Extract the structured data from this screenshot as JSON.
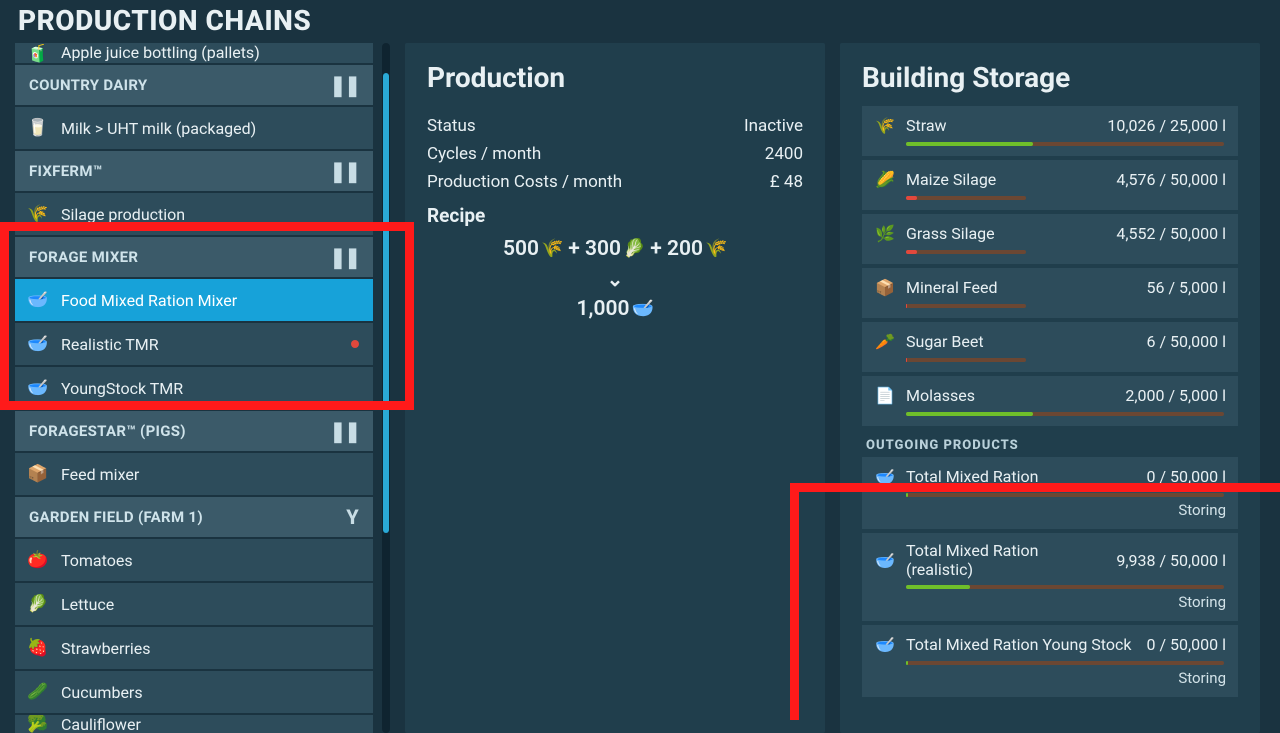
{
  "header": {
    "title": "PRODUCTION CHAINS"
  },
  "sidebar": {
    "top_partial": {
      "label": "Apple juice bottling (pallets)",
      "icon": "🧃"
    },
    "groups": [
      {
        "name": "COUNTRY DAIRY",
        "paused": true,
        "items": [
          {
            "label": "Milk > UHT milk (packaged)",
            "icon": "🥛"
          }
        ]
      },
      {
        "name": "FIXFERM™",
        "paused": true,
        "items": [
          {
            "label": "Silage production",
            "icon": "🌾"
          }
        ]
      },
      {
        "name": "FORAGE MIXER",
        "paused": true,
        "items": [
          {
            "label": "Food Mixed Ration Mixer",
            "icon": "🥣",
            "selected": true
          },
          {
            "label": "Realistic TMR",
            "icon": "🥣",
            "dot": true
          },
          {
            "label": "YoungStock TMR",
            "icon": "🥣"
          }
        ]
      },
      {
        "name": "FORAGESTAR™ (PIGS)",
        "paused": true,
        "items": [
          {
            "label": "Feed mixer",
            "icon": "📦"
          }
        ]
      },
      {
        "name": "GARDEN FIELD (FARM 1)",
        "y": true,
        "items": [
          {
            "label": "Tomatoes",
            "icon": "🍅"
          },
          {
            "label": "Lettuce",
            "icon": "🥬"
          },
          {
            "label": "Strawberries",
            "icon": "🍓"
          },
          {
            "label": "Cucumbers",
            "icon": "🥒"
          },
          {
            "label": "Cauliflower",
            "icon": "🥦"
          }
        ]
      }
    ]
  },
  "production": {
    "title": "Production",
    "rows": [
      {
        "label": "Status",
        "value": "Inactive"
      },
      {
        "label": "Cycles / month",
        "value": "2400"
      },
      {
        "label": "Production Costs / month",
        "value": "£ 48"
      }
    ],
    "recipe_label": "Recipe",
    "recipe": {
      "inputs": [
        {
          "qty": "500",
          "icon": "🌾"
        },
        {
          "qty": "300",
          "icon": "🥬"
        },
        {
          "qty": "200",
          "icon": "🌾"
        }
      ],
      "plus": "+",
      "output": {
        "qty": "1,000",
        "icon": "🥣"
      }
    }
  },
  "storage": {
    "title": "Building Storage",
    "items": [
      {
        "name": "Straw",
        "value": "10,026",
        "cap": "25,000 l",
        "icon": "🌾",
        "fill": 40,
        "low": false
      },
      {
        "name": "Maize Silage",
        "value": "4,576",
        "cap": "50,000 l",
        "icon": "🌽",
        "fill": 9,
        "low": true
      },
      {
        "name": "Grass Silage",
        "value": "4,552",
        "cap": "50,000 l",
        "icon": "🌿",
        "fill": 9,
        "low": true
      },
      {
        "name": "Mineral Feed",
        "value": "56",
        "cap": "5,000 l",
        "icon": "📦",
        "fill": 1,
        "low": true
      },
      {
        "name": "Sugar Beet",
        "value": "6",
        "cap": "50,000 l",
        "icon": "🥕",
        "fill": 0.5,
        "low": true
      },
      {
        "name": "Molasses",
        "value": "2,000",
        "cap": "5,000 l",
        "icon": "📄",
        "fill": 40,
        "low": false
      }
    ],
    "out_header": "OUTGOING PRODUCTS",
    "outgoing": [
      {
        "name": "Total Mixed Ration",
        "value": "0",
        "cap": "50,000 l",
        "icon": "🥣",
        "fill": 0.5,
        "sub": "Storing"
      },
      {
        "name": "Total Mixed Ration (realistic)",
        "value": "9,938",
        "cap": "50,000 l",
        "icon": "🥣",
        "fill": 20,
        "sub": "Storing"
      },
      {
        "name": "Total Mixed Ration Young Stock",
        "value": "0",
        "cap": "50,000 l",
        "icon": "🥣",
        "fill": 0.5,
        "sub": "Storing"
      }
    ]
  }
}
